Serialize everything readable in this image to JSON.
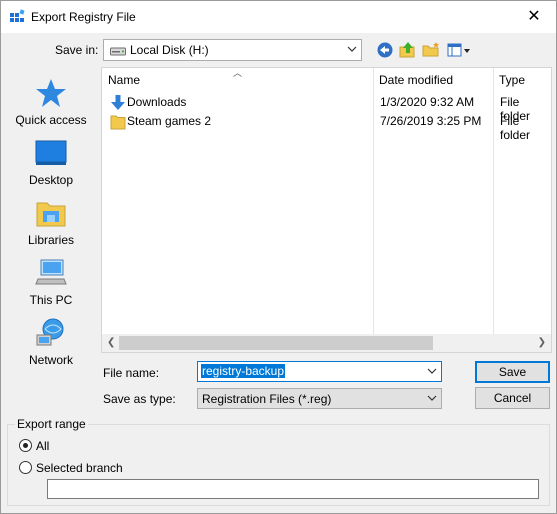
{
  "window": {
    "title": "Export Registry File",
    "close_glyph": "✕",
    "accent_color": "#0078d7"
  },
  "toolbar": {
    "save_in_label": "Save in:",
    "save_in_value": "Local Disk (H:)",
    "icons": [
      "back-icon",
      "up-folder-icon",
      "new-folder-icon",
      "view-menu-icon"
    ]
  },
  "places": [
    {
      "label": "Quick access",
      "icon": "star-icon"
    },
    {
      "label": "Desktop",
      "icon": "desktop-icon"
    },
    {
      "label": "Libraries",
      "icon": "libraries-icon"
    },
    {
      "label": "This PC",
      "icon": "computer-icon"
    },
    {
      "label": "Network",
      "icon": "network-icon"
    }
  ],
  "file_list": {
    "columns": [
      "Name",
      "Date modified",
      "Type"
    ],
    "rows": [
      {
        "name": "Downloads",
        "date": "1/3/2020 9:32 AM",
        "type": "File folder",
        "icon": "downloads-folder-icon"
      },
      {
        "name": "Steam games 2",
        "date": "7/26/2019 3:25 PM",
        "type": "File folder",
        "icon": "folder-icon"
      }
    ]
  },
  "form": {
    "file_name_label": "File name:",
    "file_name_value": "registry-backup",
    "save_as_type_label": "Save as type:",
    "save_as_type_value": "Registration Files (*.reg)"
  },
  "buttons": {
    "save": "Save",
    "cancel": "Cancel"
  },
  "export_range": {
    "title": "Export range",
    "options": [
      {
        "label": "All",
        "selected": true
      },
      {
        "label": "Selected branch",
        "selected": false
      }
    ],
    "branch_value": ""
  }
}
